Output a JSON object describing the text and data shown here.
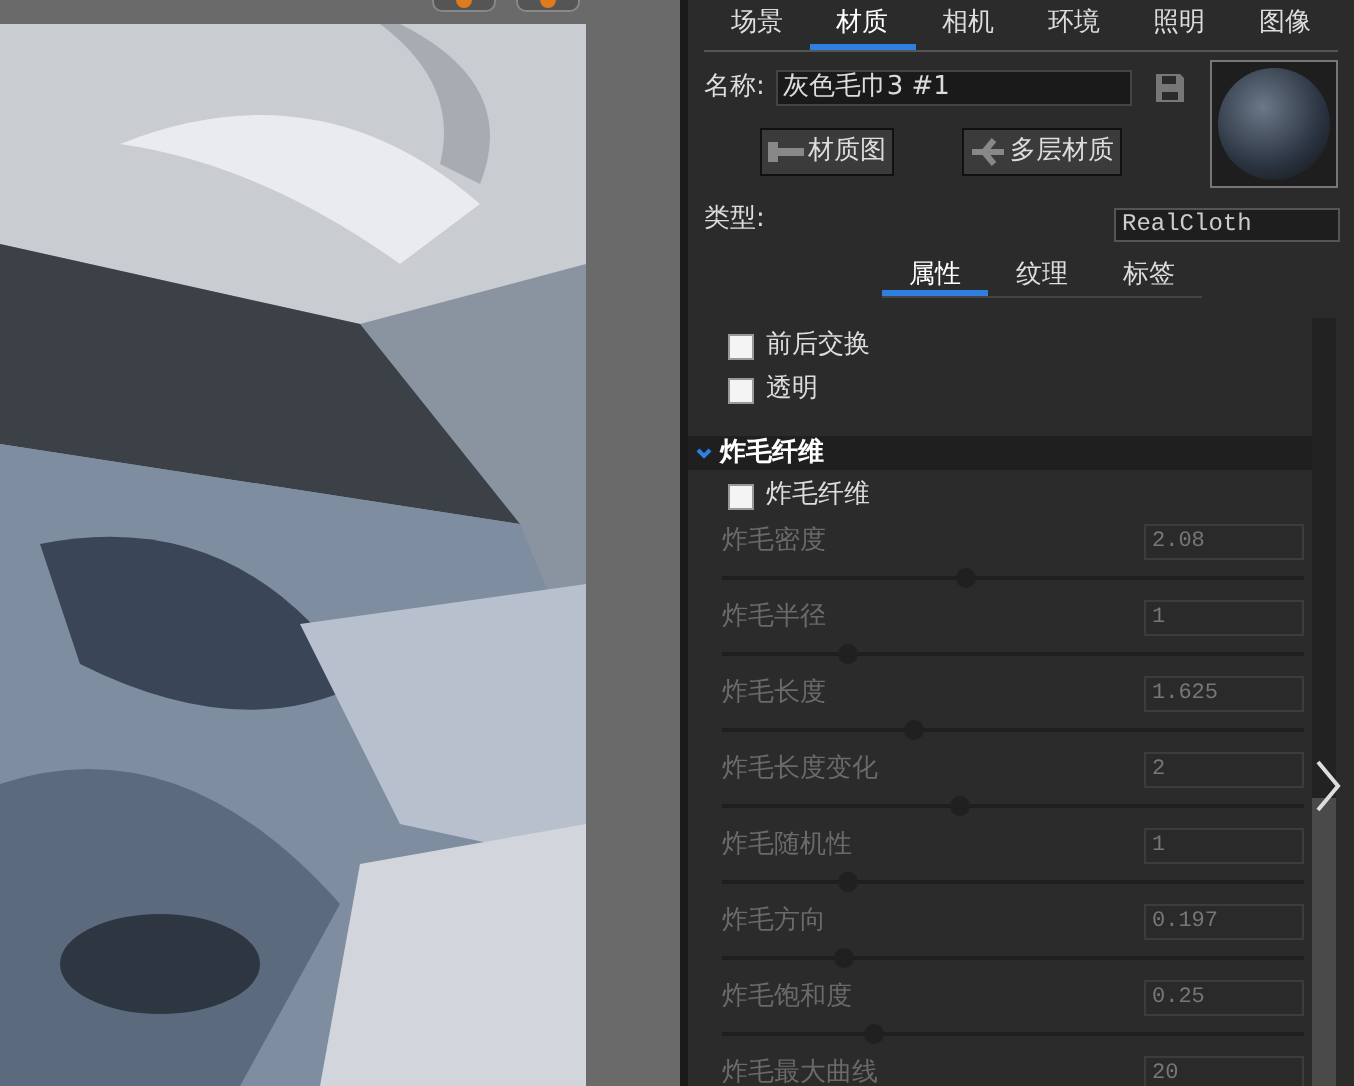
{
  "main_tabs": [
    {
      "label": "场景",
      "selected": false
    },
    {
      "label": "材质",
      "selected": true
    },
    {
      "label": "相机",
      "selected": false
    },
    {
      "label": "环境",
      "selected": false
    },
    {
      "label": "照明",
      "selected": false
    },
    {
      "label": "图像",
      "selected": false
    }
  ],
  "name_label": "名称:",
  "name_value": "灰色毛巾3 #1",
  "buttons": [
    "材质图",
    "多层材质"
  ],
  "type_label": "类型:",
  "type_value": "RealCloth",
  "sub_tabs": [
    {
      "label": "属性",
      "selected": true
    },
    {
      "label": "纹理",
      "selected": false
    },
    {
      "label": "标签",
      "selected": false
    }
  ],
  "options": [
    {
      "label": "前后交换",
      "checked": false
    },
    {
      "label": "透明",
      "checked": false
    }
  ],
  "section": {
    "title": "炸毛纤维",
    "expanded": true,
    "enable": {
      "label": "炸毛纤维",
      "checked": false
    },
    "sliders": [
      {
        "label": "炸毛密度",
        "value": "2.08",
        "level": 0.42,
        "disabled": true
      },
      {
        "label": "炸毛半径",
        "value": "1",
        "level": 0.215,
        "disabled": true
      },
      {
        "label": "炸毛长度",
        "value": "1.625",
        "level": 0.33,
        "disabled": true
      },
      {
        "label": "炸毛长度变化",
        "value": "2",
        "level": 0.41,
        "disabled": true
      },
      {
        "label": "炸毛随机性",
        "value": "1",
        "level": 0.215,
        "disabled": true
      },
      {
        "label": "炸毛方向",
        "value": "0.197",
        "level": 0.21,
        "disabled": true
      },
      {
        "label": "炸毛饱和度",
        "value": "0.25",
        "level": 0.26,
        "disabled": true
      },
      {
        "label": "炸毛最大曲线",
        "value": "20",
        "disabled": true
      }
    ]
  }
}
